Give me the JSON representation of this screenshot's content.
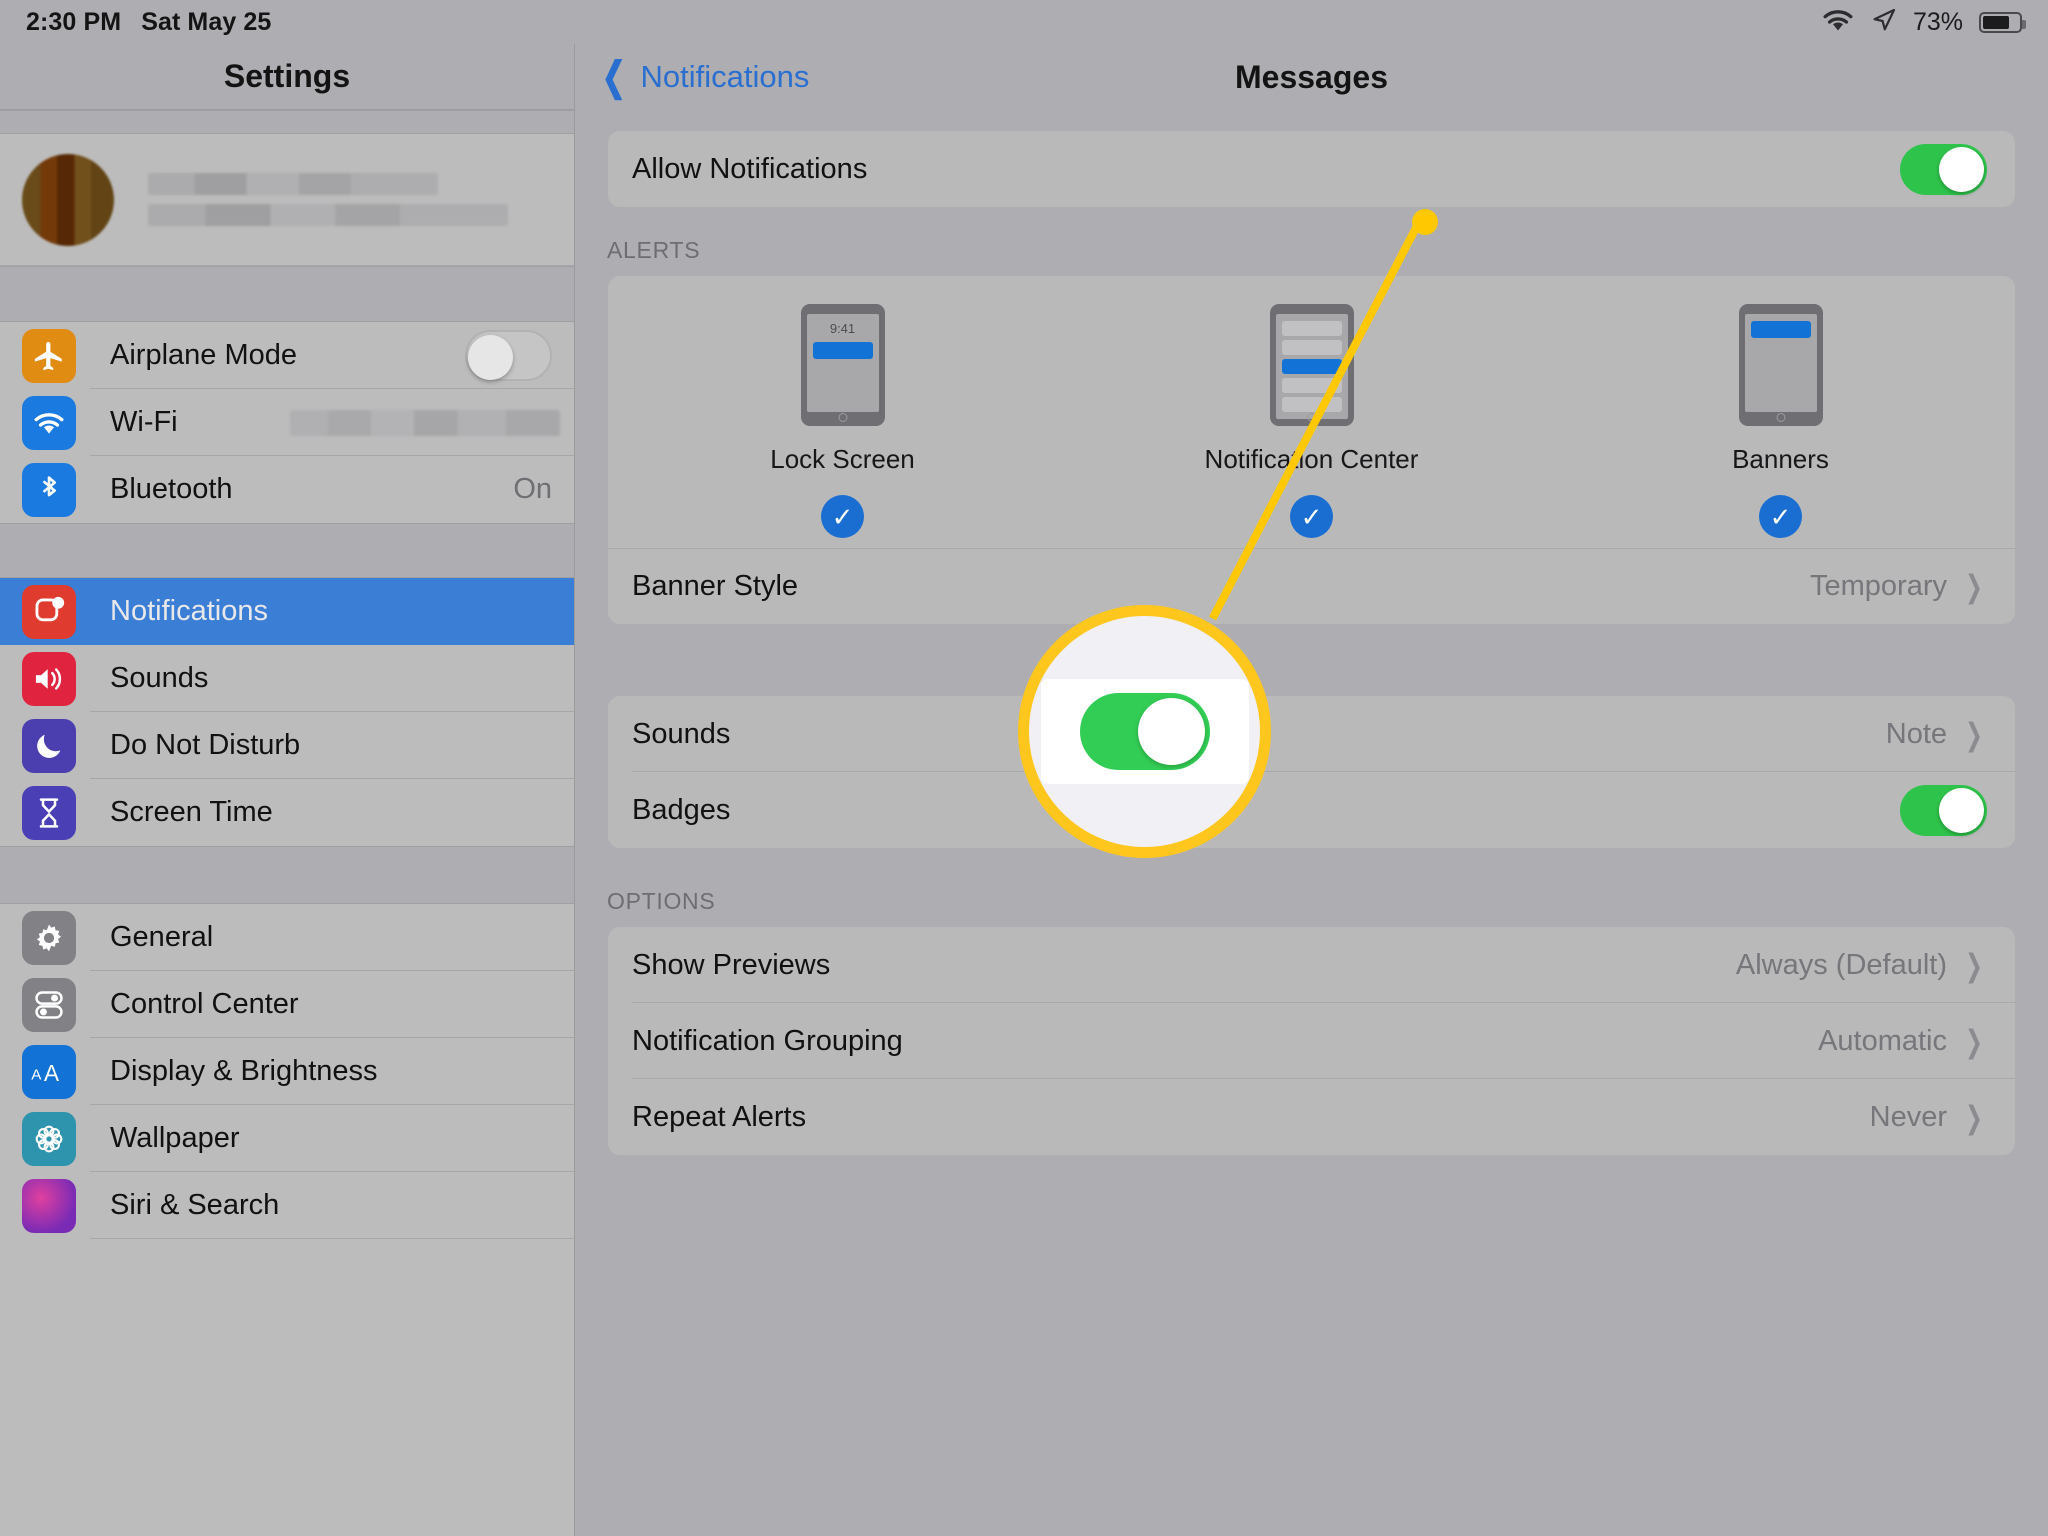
{
  "status_bar": {
    "time": "2:30 PM",
    "date": "Sat May 25",
    "wifi_icon": "wifi-icon",
    "location_icon": "location-arrow-icon",
    "battery_percent": "73%",
    "battery_level": 73
  },
  "sidebar": {
    "title": "Settings",
    "account": {
      "avatar": "user-avatar",
      "name_redacted": true,
      "subtitle_redacted": true
    },
    "groups": [
      {
        "items": [
          {
            "label": "Airplane Mode",
            "icon": "airplane-icon",
            "icon_color": "#e08b11",
            "control": "toggle",
            "toggle_on": false
          },
          {
            "label": "Wi-Fi",
            "icon": "wifi-icon",
            "icon_color": "#1b7ae0",
            "control": "blurred-value"
          },
          {
            "label": "Bluetooth",
            "icon": "bluetooth-icon",
            "icon_color": "#1b7ae0",
            "control": "value",
            "value": "On"
          }
        ]
      },
      {
        "items": [
          {
            "label": "Notifications",
            "icon": "notifications-icon",
            "icon_color": "#e03b2f",
            "selected": true
          },
          {
            "label": "Sounds",
            "icon": "speaker-icon",
            "icon_color": "#e0243f",
            "selected": false
          },
          {
            "label": "Do Not Disturb",
            "icon": "moon-icon",
            "icon_color": "#4b3fb0",
            "selected": false
          },
          {
            "label": "Screen Time",
            "icon": "hourglass-icon",
            "icon_color": "#4a3fb5",
            "selected": false
          }
        ]
      },
      {
        "items": [
          {
            "label": "General",
            "icon": "gear-icon",
            "icon_color": "#818186",
            "selected": false
          },
          {
            "label": "Control Center",
            "icon": "control-center-icon",
            "icon_color": "#818186",
            "selected": false
          },
          {
            "label": "Display & Brightness",
            "icon": "text-size-icon",
            "icon_color": "#1272d6",
            "selected": false
          },
          {
            "label": "Wallpaper",
            "icon": "flower-icon",
            "icon_color": "#2e93ad",
            "selected": false
          },
          {
            "label": "Siri & Search",
            "icon": "siri-icon",
            "icon_color": "#6b2f8e",
            "selected": false
          }
        ]
      }
    ]
  },
  "detail": {
    "back_label": "Notifications",
    "back_icon": "chevron-left-icon",
    "title": "Messages",
    "allow_notifications": {
      "label": "Allow Notifications",
      "toggle_on": true
    },
    "alerts_section": {
      "header": "ALERTS",
      "options": [
        {
          "name": "Lock Screen",
          "checked": true,
          "check_icon": "checkmark-icon",
          "device_time": "9:41"
        },
        {
          "name": "Notification Center",
          "checked": true,
          "check_icon": "checkmark-icon"
        },
        {
          "name": "Banners",
          "checked": true,
          "check_icon": "checkmark-icon"
        }
      ],
      "banner_style": {
        "label": "Banner Style",
        "value": "Temporary",
        "disclosure_icon": "chevron-right-icon"
      }
    },
    "sounds_section": {
      "rows": [
        {
          "label": "Sounds",
          "value": "Note",
          "control": "value",
          "disclosure_icon": "chevron-right-icon"
        },
        {
          "label": "Badges",
          "control": "toggle",
          "toggle_on": true
        }
      ]
    },
    "options_section": {
      "header": "OPTIONS",
      "rows": [
        {
          "label": "Show Previews",
          "value": "Always (Default)",
          "disclosure_icon": "chevron-right-icon"
        },
        {
          "label": "Notification Grouping",
          "value": "Automatic",
          "disclosure_icon": "chevron-right-icon"
        },
        {
          "label": "Repeat Alerts",
          "value": "Never",
          "disclosure_icon": "chevron-right-icon"
        }
      ]
    }
  },
  "annotation": {
    "highlight_color": "#ffc61e",
    "dot_icon": "callout-dot",
    "line_icon": "callout-line",
    "magnifier_icon": "magnifier-circle",
    "magnified_control": "allow-notifications-toggle",
    "magnified_toggle_on": true
  }
}
